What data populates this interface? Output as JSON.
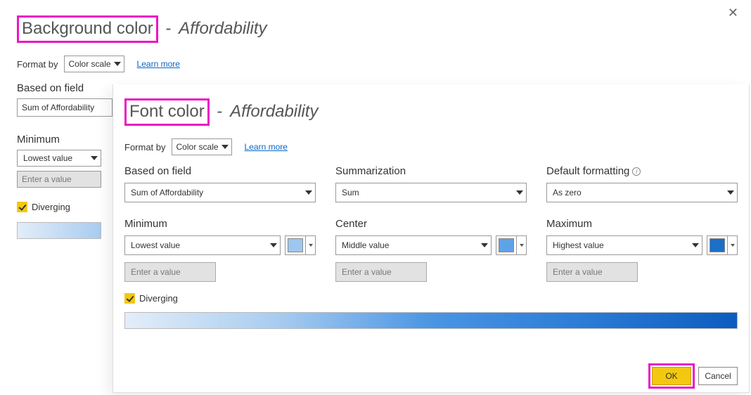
{
  "back": {
    "title_main": "Background color",
    "title_sub": "Affordability",
    "format_by_label": "Format by",
    "format_by_value": "Color scale",
    "learn_more": "Learn more",
    "based_on_field_label": "Based on field",
    "based_on_field_value": "Sum of Affordability",
    "minimum_label": "Minimum",
    "minimum_value": "Lowest value",
    "value_placeholder": "Enter a value",
    "diverging_label": "Diverging"
  },
  "front": {
    "title_main": "Font color",
    "title_sub": "Affordability",
    "format_by_label": "Format by",
    "format_by_value": "Color scale",
    "learn_more": "Learn more",
    "based_on_field_label": "Based on field",
    "based_on_field_value": "Sum of Affordability",
    "summarization_label": "Summarization",
    "summarization_value": "Sum",
    "default_formatting_label": "Default formatting",
    "default_formatting_value": "As zero",
    "minimum_label": "Minimum",
    "minimum_value": "Lowest value",
    "minimum_color": "#9ec7ef",
    "center_label": "Center",
    "center_value": "Middle value",
    "center_color": "#5fa3e6",
    "maximum_label": "Maximum",
    "maximum_value": "Highest value",
    "maximum_color": "#1b6fc9",
    "value_placeholder": "Enter a value",
    "diverging_label": "Diverging",
    "ok_label": "OK",
    "cancel_label": "Cancel"
  }
}
